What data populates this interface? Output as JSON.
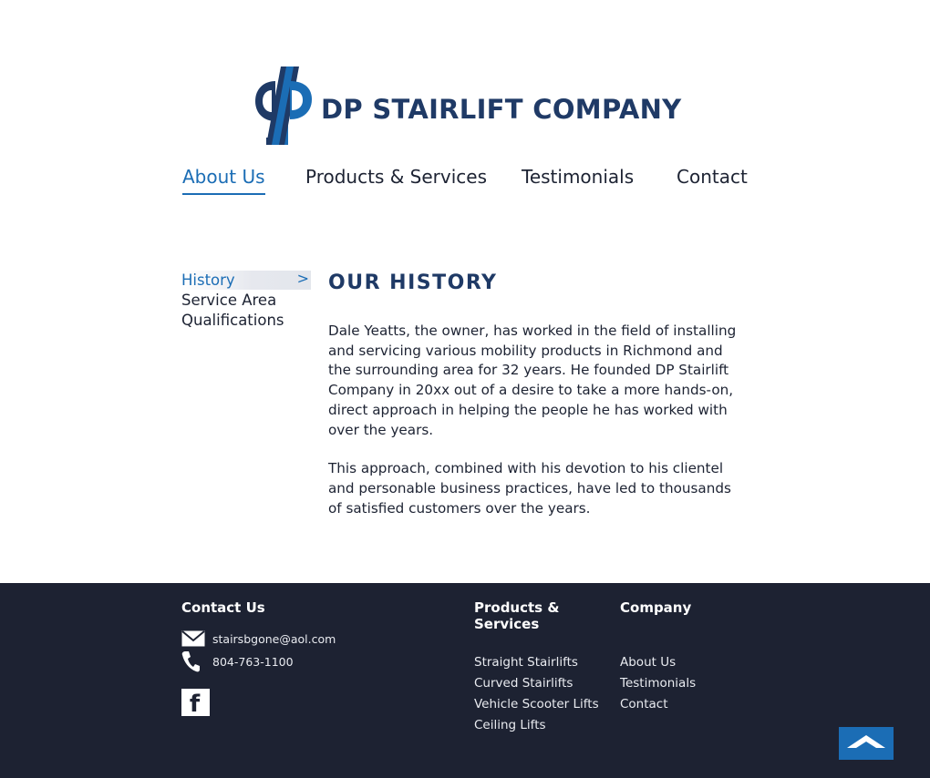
{
  "logo": {
    "text": "DP STAIRLIFT COMPANY",
    "color": "#1f3a66",
    "accent_color": "#1b6db5"
  },
  "nav": {
    "items": [
      {
        "label": "About Us",
        "active": true
      },
      {
        "label": "Products & Services",
        "active": false
      },
      {
        "label": "Testimonials",
        "active": false
      },
      {
        "label": "Contact",
        "active": false
      }
    ]
  },
  "side_nav": {
    "items": [
      {
        "label": "History",
        "active": true,
        "indicator": ">"
      },
      {
        "label": "Service Area",
        "active": false
      },
      {
        "label": "Qualifications",
        "active": false
      }
    ]
  },
  "content": {
    "title": "OUR HISTORY",
    "paragraphs": [
      "Dale Yeatts, the owner, has worked in the field of installing and servicing various mobility products in Richmond and the surrounding area for 32 years. He founded DP Stairlift Company in 20xx out of a desire to take a more hands-on, direct approach in helping the people he has worked with over the years.",
      "This approach, combined with his devotion to his clientel and personable business practices, have led to thousands of satisfied customers over the years."
    ]
  },
  "footer": {
    "background": "#1d2232",
    "contact": {
      "heading": "Contact Us",
      "email": "stairsbgone@aol.com",
      "phone": "804-763-1100",
      "email_icon": "mail-icon",
      "phone_icon": "phone-icon",
      "social_icon": "facebook-icon"
    },
    "products": {
      "heading": "Products & Services",
      "links": [
        "Straight Stairlifts",
        "Curved Stairlifts",
        "Vehicle Scooter Lifts",
        "Ceiling Lifts"
      ]
    },
    "company": {
      "heading": "Company",
      "links": [
        "About Us",
        "Testimonials",
        "Contact"
      ]
    },
    "back_to_top_icon": "chevron-up-icon"
  }
}
